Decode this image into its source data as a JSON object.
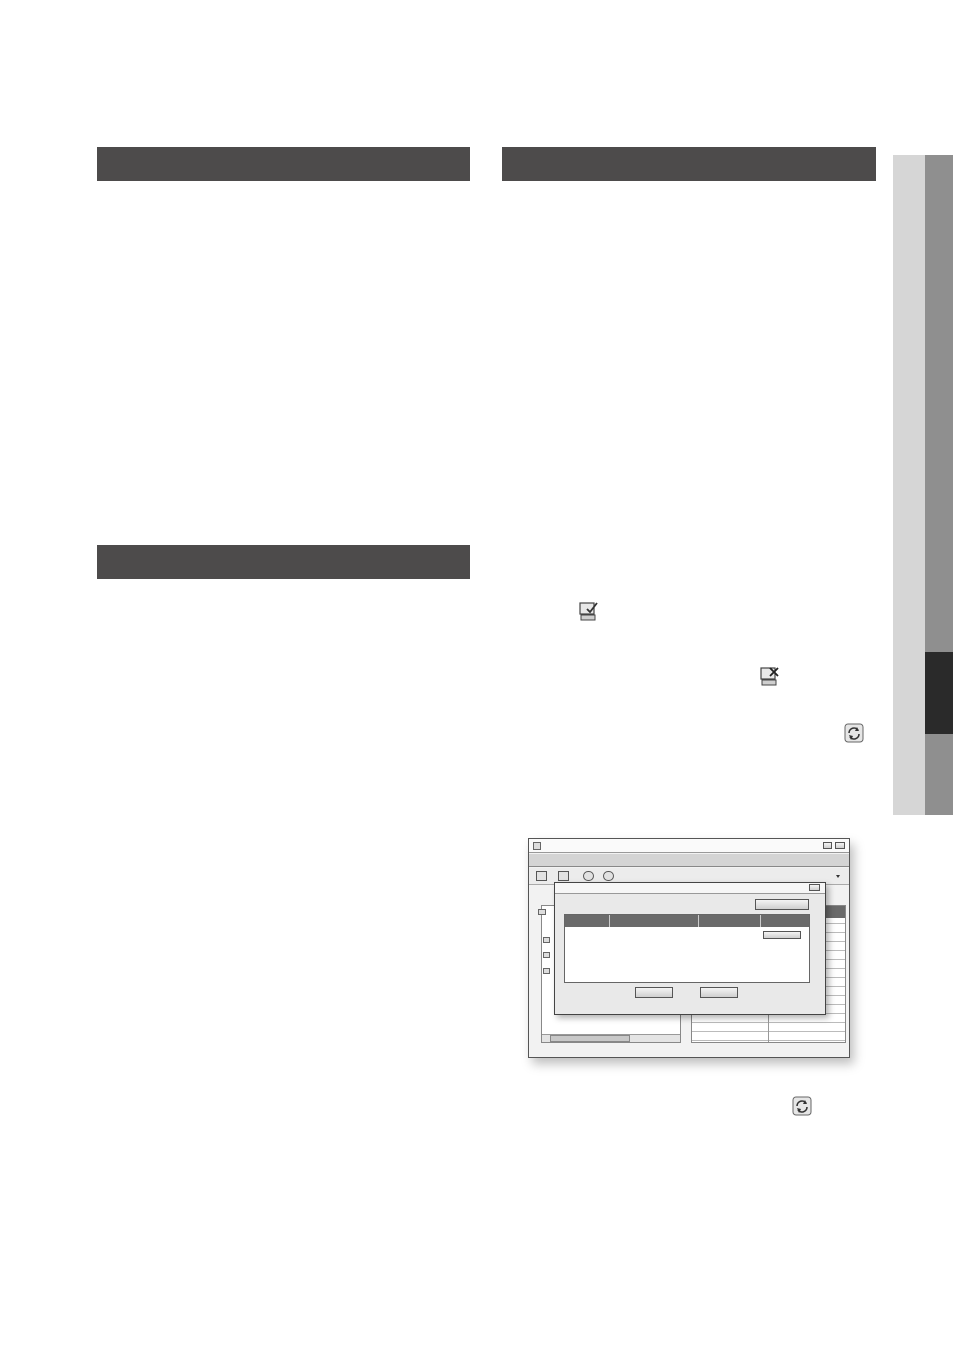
{
  "page": {
    "background": "#ffffff",
    "bar_color": "#4d4b4b"
  },
  "section_bars": [
    {
      "title": ""
    },
    {
      "title": ""
    },
    {
      "title": ""
    }
  ],
  "side_tabs": {
    "light": "#d6d6d6",
    "mid": "#8f8f8f",
    "dark": "#2a2a2a"
  },
  "icons": [
    "disk-check-icon",
    "disk-x-icon",
    "refresh-icon",
    "refresh-icon"
  ],
  "dialog": {
    "window_title": "",
    "dialog_title": "",
    "top_button_label": "",
    "row_button_label": "",
    "ok_label": "",
    "cancel_label": "",
    "columns": [
      "",
      "",
      "",
      ""
    ]
  }
}
